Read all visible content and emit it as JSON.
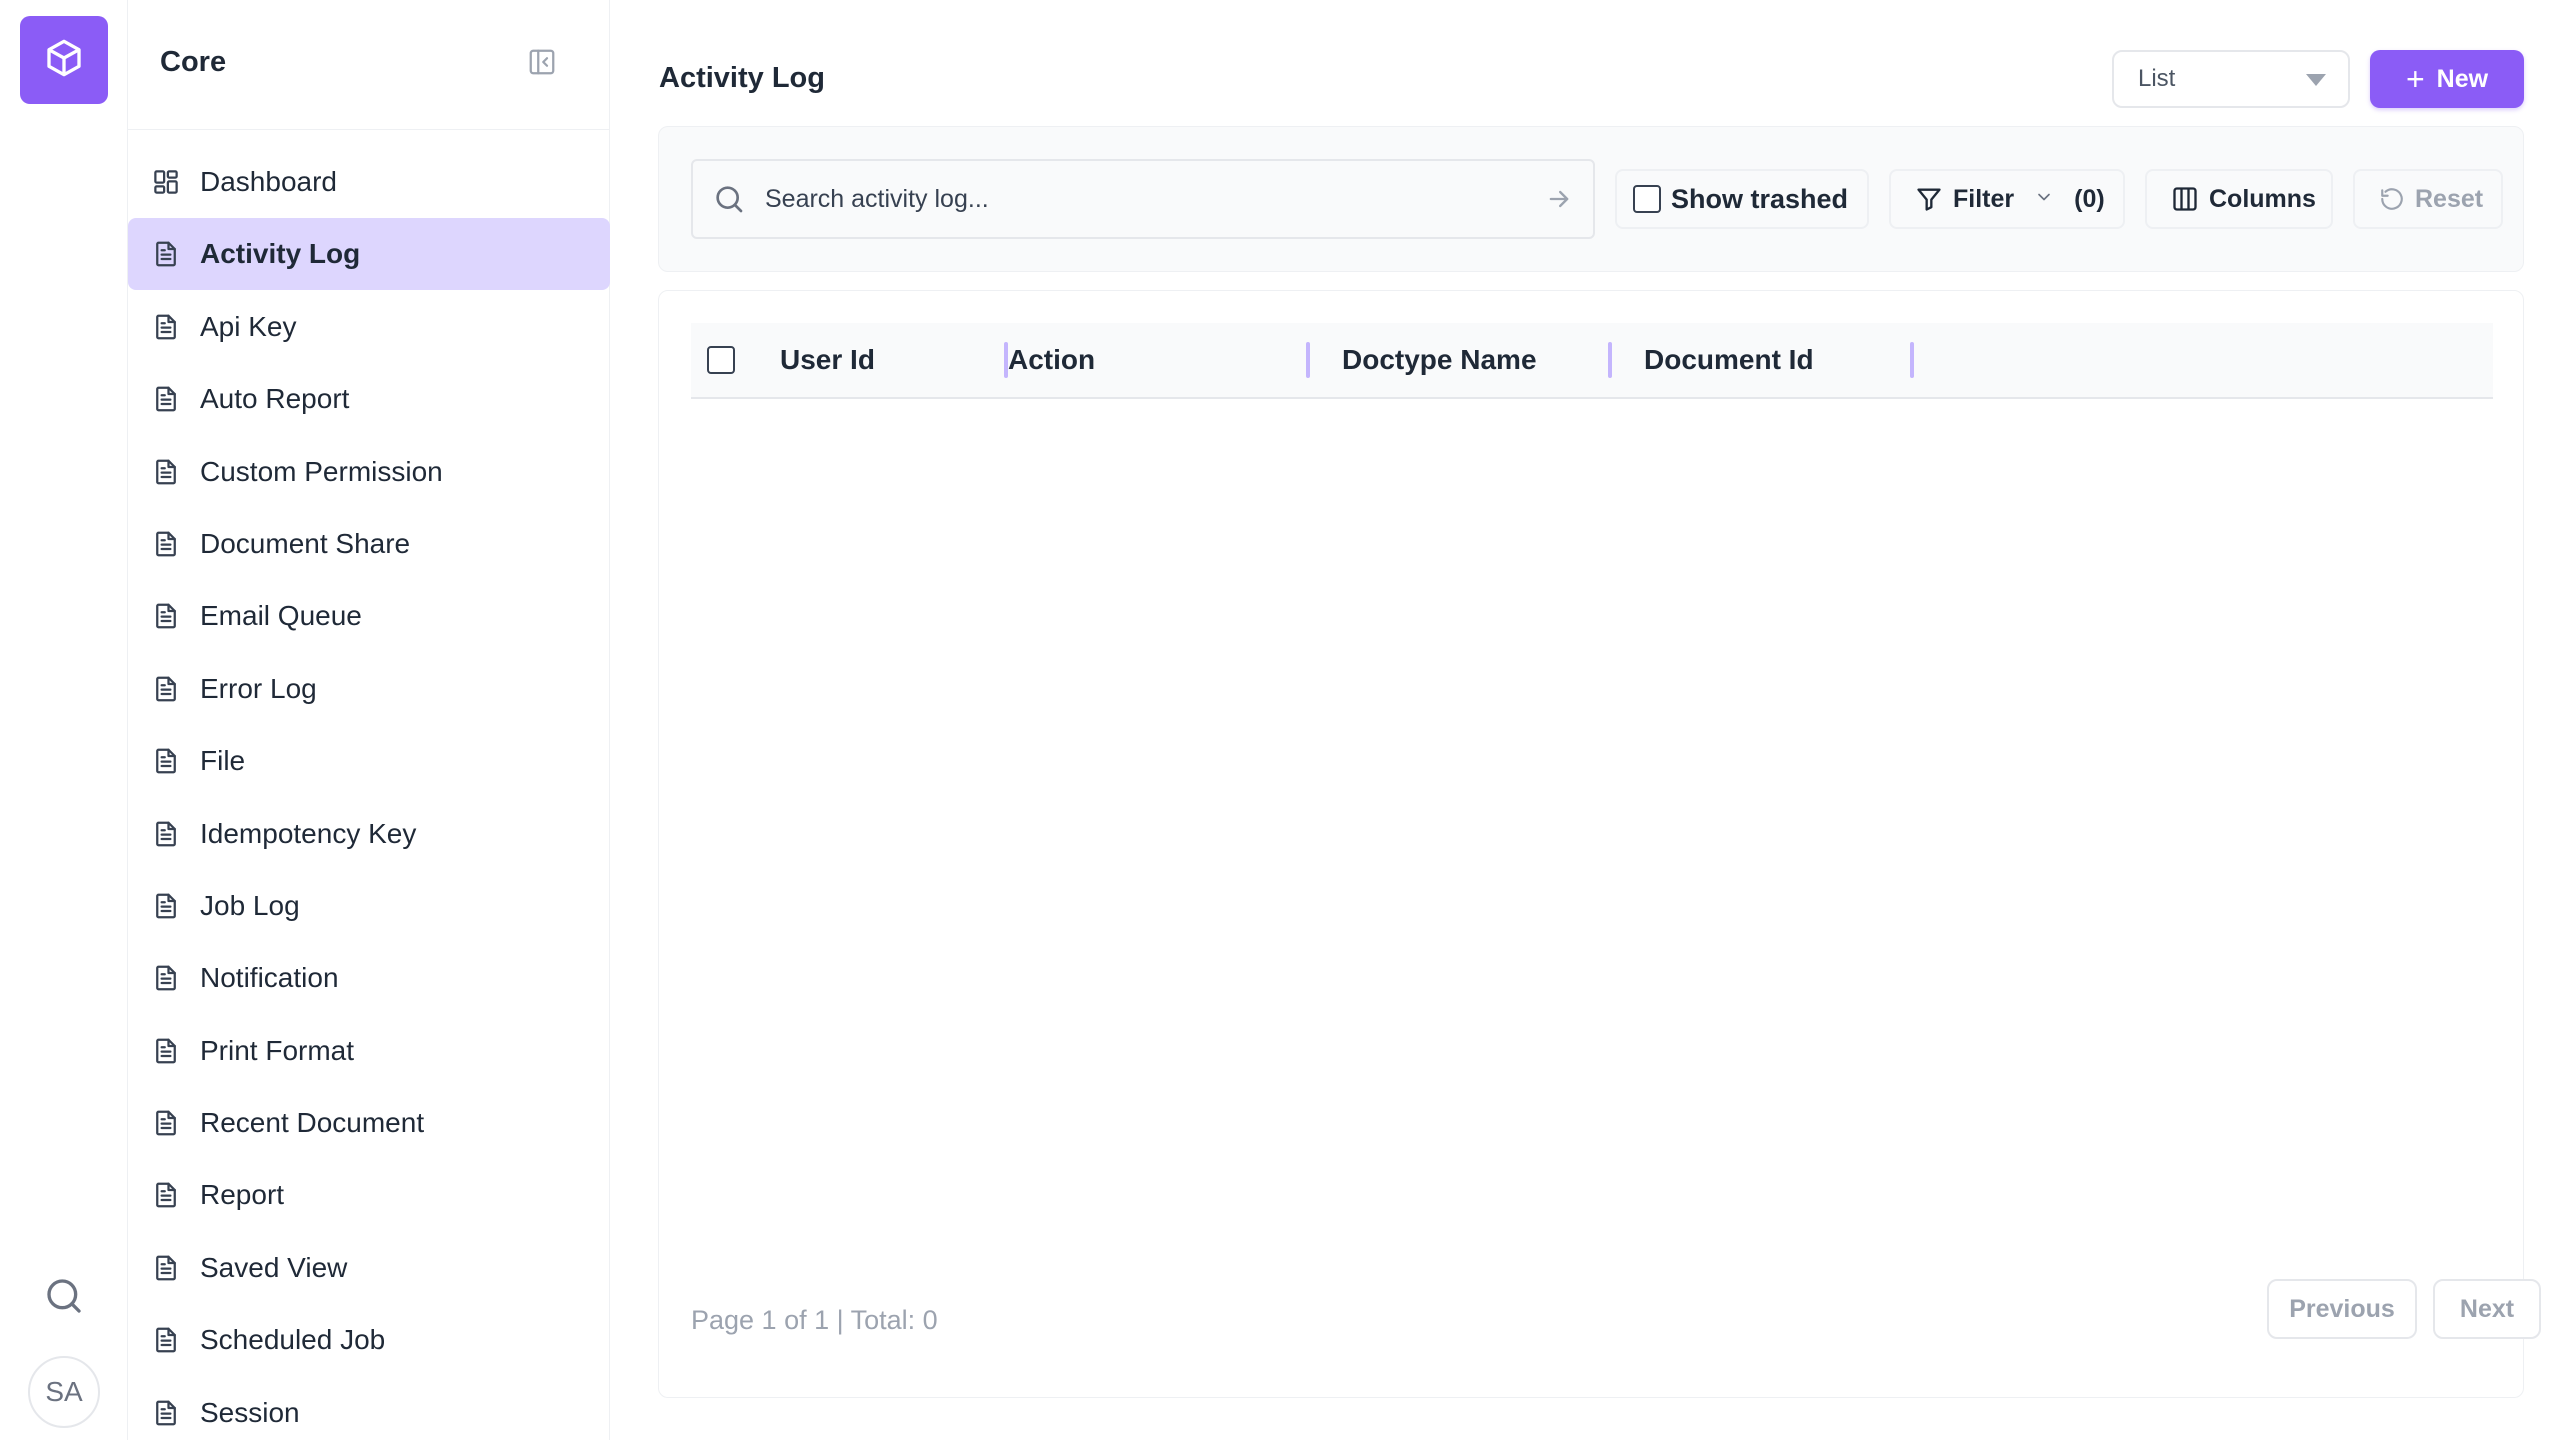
{
  "rail": {
    "logo_icon": "cube-icon",
    "search_icon": "search-icon",
    "avatar_initials": "SA"
  },
  "sidebar": {
    "title": "Core",
    "items": [
      {
        "label": "Dashboard",
        "icon": "dashboard-icon",
        "active": false
      },
      {
        "label": "Activity Log",
        "icon": "document-icon",
        "active": true
      },
      {
        "label": "Api Key",
        "icon": "document-icon",
        "active": false
      },
      {
        "label": "Auto Report",
        "icon": "document-icon",
        "active": false
      },
      {
        "label": "Custom Permission",
        "icon": "document-icon",
        "active": false
      },
      {
        "label": "Document Share",
        "icon": "document-icon",
        "active": false
      },
      {
        "label": "Email Queue",
        "icon": "document-icon",
        "active": false
      },
      {
        "label": "Error Log",
        "icon": "document-icon",
        "active": false
      },
      {
        "label": "File",
        "icon": "document-icon",
        "active": false
      },
      {
        "label": "Idempotency Key",
        "icon": "document-icon",
        "active": false
      },
      {
        "label": "Job Log",
        "icon": "document-icon",
        "active": false
      },
      {
        "label": "Notification",
        "icon": "document-icon",
        "active": false
      },
      {
        "label": "Print Format",
        "icon": "document-icon",
        "active": false
      },
      {
        "label": "Recent Document",
        "icon": "document-icon",
        "active": false
      },
      {
        "label": "Report",
        "icon": "document-icon",
        "active": false
      },
      {
        "label": "Saved View",
        "icon": "document-icon",
        "active": false
      },
      {
        "label": "Scheduled Job",
        "icon": "document-icon",
        "active": false
      },
      {
        "label": "Session",
        "icon": "document-icon",
        "active": false
      }
    ]
  },
  "header": {
    "title": "Activity Log",
    "view_select": "List",
    "new_label": "New"
  },
  "toolbar": {
    "search_placeholder": "Search activity log...",
    "show_trashed": "Show trashed",
    "filter_label": "Filter",
    "filter_count": "(0)",
    "columns_label": "Columns",
    "reset_label": "Reset"
  },
  "table": {
    "columns": [
      "User Id",
      "Action",
      "Doctype Name",
      "Document Id"
    ]
  },
  "pagination": {
    "summary": "Page 1 of 1 | Total: 0",
    "previous": "Previous",
    "next": "Next"
  },
  "colors": {
    "accent": "#8b5cf6",
    "active_bg": "#ddd6fe"
  }
}
